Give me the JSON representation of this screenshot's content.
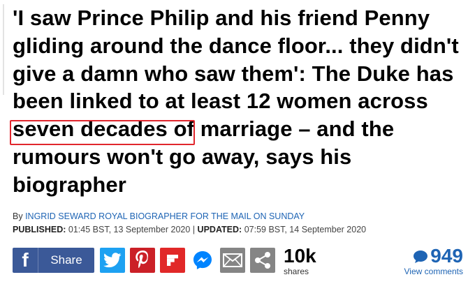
{
  "article": {
    "headline": "'I saw Prince Philip and his friend Penny gliding around the dance floor... they didn't give a damn who saw them': The Duke has been linked to at least 12 women across seven decades of marriage – and the rumours won't go away, says his biographer",
    "byline_prefix": "By",
    "byline_author": "INGRID SEWARD ROYAL BIOGRAPHER FOR THE MAIL ON SUNDAY",
    "published_label": "PUBLISHED:",
    "published_value": "01:45 BST, 13 September 2020",
    "separator": "|",
    "updated_label": "UPDATED:",
    "updated_value": "07:59 BST, 14 September 2020"
  },
  "share_bar": {
    "facebook_label": "Share",
    "share_count": "10k",
    "share_count_label": "shares",
    "comment_count": "949",
    "comment_label": "View comments",
    "icons": [
      "facebook-icon",
      "twitter-icon",
      "pinterest-icon",
      "flipboard-icon",
      "messenger-icon",
      "email-icon",
      "share-icon",
      "comment-bubble-icon"
    ]
  },
  "colors": {
    "facebook": "#3b5998",
    "twitter": "#1da1f2",
    "pinterest": "#cb2027",
    "flipboard": "#e12828",
    "gray_button": "#858585",
    "link_blue": "#1e64b4",
    "highlight_red": "#e1262d"
  }
}
